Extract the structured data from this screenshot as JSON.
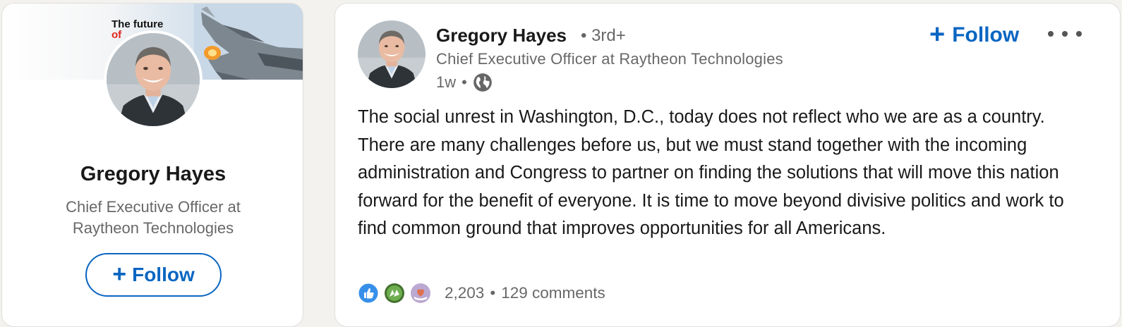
{
  "profile_card": {
    "banner_text_line1": "The future",
    "banner_text_line2": "of",
    "name": "Gregory Hayes",
    "headline": "Chief Executive Officer at Raytheon Technologies",
    "follow_label": "Follow",
    "follow_icon": "plus-icon"
  },
  "post": {
    "author_name": "Gregory Hayes",
    "degree": "• 3rd+",
    "author_headline": "Chief Executive Officer at Raytheon Technologies",
    "time": "1w",
    "visibility_icon": "globe-icon",
    "follow_label": "Follow",
    "more_icon": "ellipsis-icon",
    "text": "The social unrest in Washington, D.C., today does not reflect who we are as a country. There are many challenges before us, but we must stand together with the incoming administration and Congress to partner on finding the solutions that will move this nation forward for the benefit of everyone. It is time to move beyond divisive politics and work to find common ground that improves opportunities for all Americans.",
    "reactions": [
      "like-icon",
      "celebrate-icon",
      "love-icon"
    ],
    "reaction_count": "2,203",
    "comments": "129 comments"
  },
  "colors": {
    "accent": "#0a66c2",
    "background": "#f3f2ef",
    "card": "#ffffff",
    "secondary_text": "#666666"
  }
}
